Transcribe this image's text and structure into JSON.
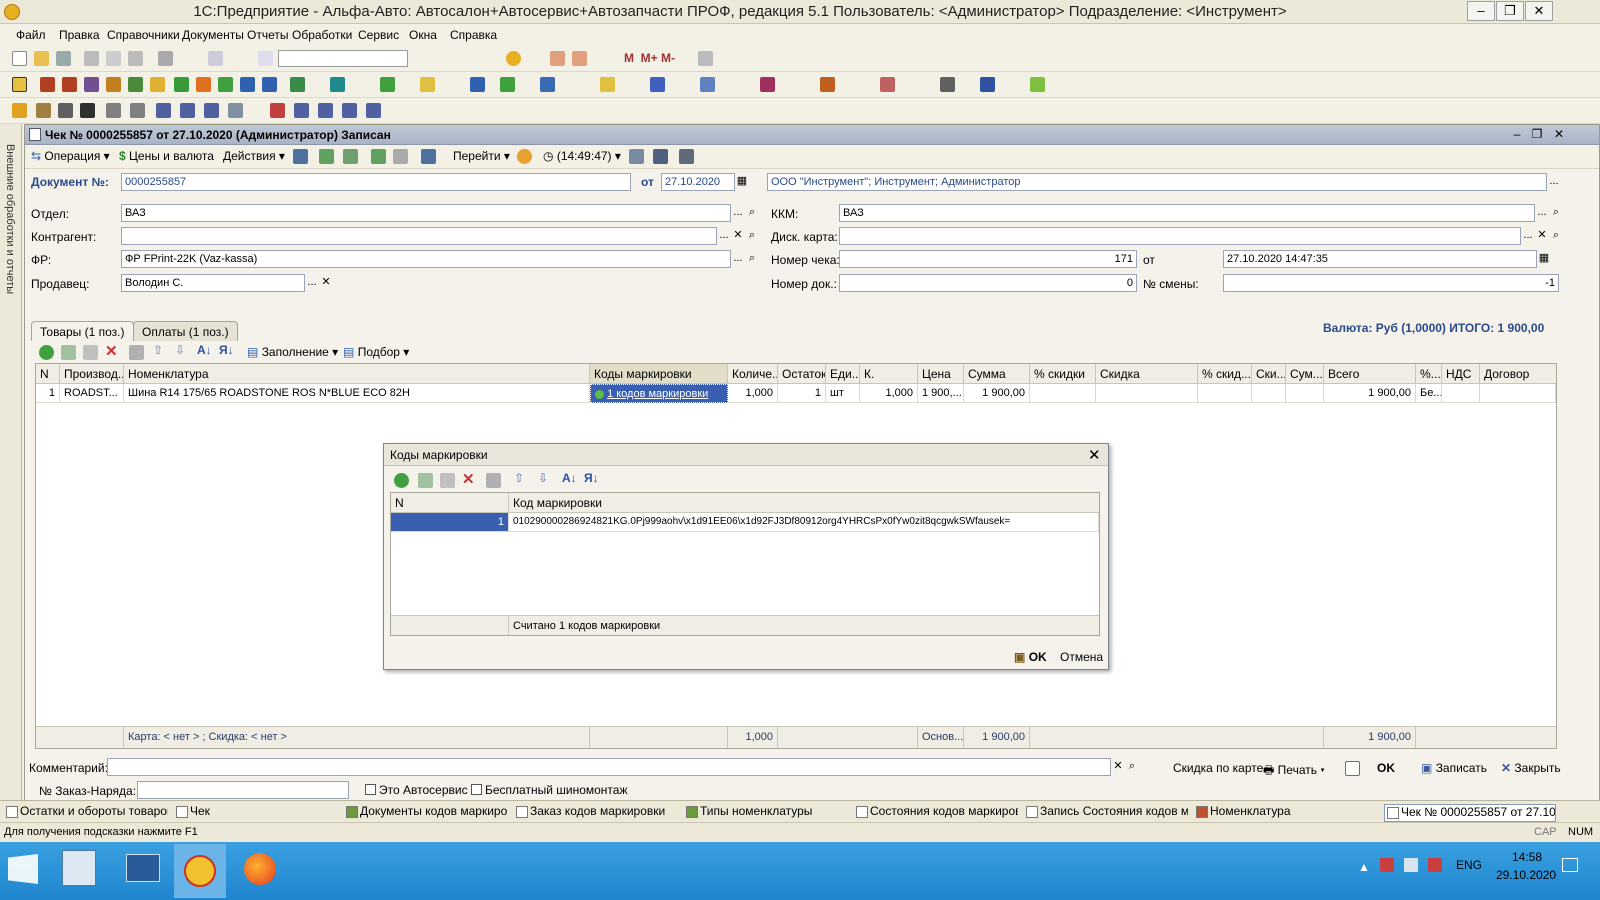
{
  "window": {
    "title": "1С:Предприятие - Альфа-Авто: Автосалон+Автосервис+Автозапчасти ПРОФ, редакция 5.1    Пользователь: <Администратор>    Подразделение: <Инструмент>"
  },
  "menu": [
    "Файл",
    "Правка",
    "Справочники",
    "Документы",
    "Отчеты",
    "Обработки",
    "Сервис",
    "Окна",
    "Справка"
  ],
  "sidepanel": {
    "label": "Внешние обработки и отчеты"
  },
  "doc": {
    "title": "Чек № 0000255857 от 27.10.2020 (Администратор) Записан",
    "toolbar": {
      "operation": "Операция",
      "prices": "Цены и валюта",
      "actions": "Действия",
      "goto": "Перейти",
      "time": "(14:49:47)"
    },
    "docnum_label": "Документ №:",
    "docnum": "0000255857",
    "from_label": "от",
    "date": "27.10.2020",
    "org": "ООО \"Инструмент\"; Инструмент; Администратор",
    "dept_label": "Отдел:",
    "dept": "ВАЗ",
    "contractor_label": "Контрагент:",
    "contractor": "",
    "fr_label": "ФР:",
    "fr": "ФР FPrint-22K (Vaz-kassa)",
    "seller_label": "Продавец:",
    "seller": "Володин С.",
    "kkm_label": "ККМ:",
    "kkm": "ВАЗ",
    "card_label": "Диск. карта:",
    "card": "",
    "receipt_label": "Номер чека:",
    "receipt": "171",
    "receipt_from": "от",
    "receipt_date": "27.10.2020 14:47:35",
    "docno_label": "Номер док.:",
    "docno": "0",
    "shift_label": "№ смены:",
    "shift": "-1",
    "tab_goods": "Товары (1 поз.)",
    "tab_payments": "Оплаты (1 поз.)",
    "total": "Валюта: Руб (1,0000) ИТОГО: 1 900,00",
    "grid_toolbar": {
      "fill": "Заполнение",
      "pick": "Подбор"
    },
    "columns": [
      "N",
      "Производ...",
      "Номенклатура",
      "Коды маркировки",
      "Количе...",
      "Остаток",
      "Еди...",
      "К.",
      "Цена",
      "Сумма",
      "% скидки",
      "Скидка",
      "% скид...",
      "Ски...",
      "Сум...",
      "Всего",
      "%...",
      "НДС",
      "Договор"
    ],
    "row": {
      "n": "1",
      "maker": "ROADST...",
      "item": "Шина R14 175/65 ROADSTONE ROS N*BLUE ECO 82H",
      "codes": "1 кодов маркировки",
      "qty": "1,000",
      "rest": "1",
      "unit": "шт",
      "k": "1,000",
      "price": "1 900,...",
      "sum": "1 900,00",
      "total": "1 900,00",
      "vat": "Бе..."
    },
    "footer": {
      "card": "Карта: < нет > ; Скидка: < нет >",
      "qty": "1,000",
      "base": "Основ...",
      "sum": "1 900,00",
      "total": "1 900,00"
    },
    "comment_label": "Комментарий:",
    "comment": "",
    "order_label": "№ Заказ-Наряда:",
    "chk_autoservice": "Это Автосервис",
    "chk_free": "Бесплатный шиномонтаж",
    "btn_discount": "Скидка по карте",
    "btn_print": "Печать",
    "btn_ok": "OK",
    "btn_save": "Записать",
    "btn_close": "Закрыть"
  },
  "dialog": {
    "title": "Коды маркировки",
    "col_n": "N",
    "col_code": "Код маркировки",
    "row_n": "1",
    "row_code": "010290000286924821KG.0Pj999aohv\\x1d91EE06\\x1d92FJ3Df80912org4YHRCsPx0fYw0zit8qcgwkSWfausek=",
    "footer": "Считано 1 кодов маркировки",
    "ok": "OK",
    "cancel": "Отмена"
  },
  "taskbar_items": [
    "Остатки и обороты товаров ...",
    "Чек",
    "Документы кодов маркиро...",
    "Заказ кодов маркировки",
    "Типы номенклатуры",
    "Состояния кодов маркиров...",
    "Запись Состояния кодов ма...",
    "Номенклатура",
    "Чек № 0000255857 от 27.10..."
  ],
  "status": {
    "hint": "Для получения подсказки нажмите F1",
    "cap": "CAP",
    "num": "NUM"
  },
  "tray": {
    "lang": "ENG",
    "time": "14:58",
    "date": "29.10.2020"
  }
}
